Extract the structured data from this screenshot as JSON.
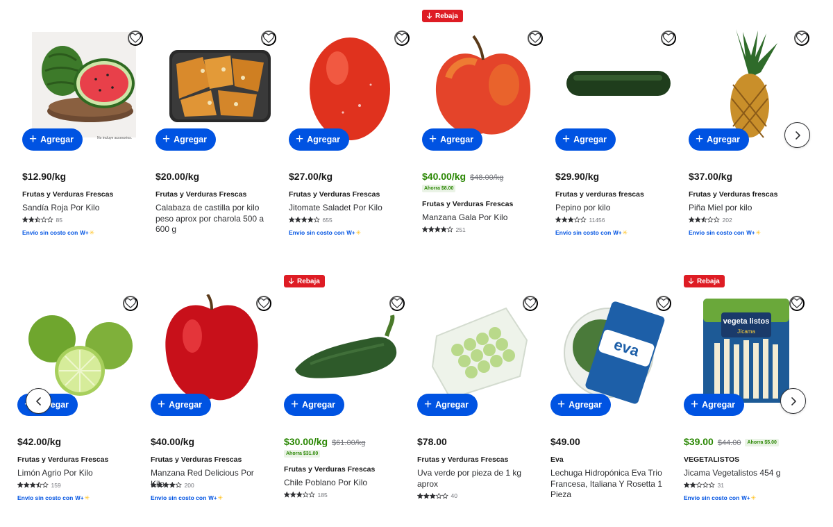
{
  "labels": {
    "add": "Agregar",
    "rebaja": "Rebaja",
    "shipping": "Envío sin costo con",
    "wplus": "W+"
  },
  "colors": {
    "primary": "#0053e2",
    "sale": "#2a8703",
    "badge": "#de1c24",
    "star": "#2e2f32"
  },
  "row1": [
    {
      "price": "$12.90/kg",
      "brand": "Frutas y Verduras Frescas",
      "name": "Sandía Roja Por Kilo",
      "rating": 2.5,
      "reviews": "85",
      "shipping": true,
      "image": "watermelon",
      "image_caption": "No incluye accesorios."
    },
    {
      "price": "$20.00/kg",
      "brand": "Frutas y Verduras Frescas",
      "name": "Calabaza de castilla por kilo peso aprox por charola 500 a 600 g",
      "image": "squash"
    },
    {
      "price": "$27.00/kg",
      "brand": "Frutas y Verduras Frescas",
      "name": "Jitomate Saladet Por Kilo",
      "rating": 4,
      "reviews": "655",
      "shipping": true,
      "image": "tomato"
    },
    {
      "price": "$40.00/kg",
      "was": "$48.00/kg",
      "ahorra": "Ahorra $8.00",
      "rebaja": true,
      "brand": "Frutas y Verduras Frescas",
      "name": "Manzana Gala Por Kilo",
      "rating": 4,
      "reviews": "251",
      "image": "gala-apple"
    },
    {
      "price": "$29.90/kg",
      "brand": "Frutas y verduras frescas",
      "name": "Pepino por kilo",
      "rating": 3,
      "reviews": "11456",
      "shipping": true,
      "image": "cucumber"
    },
    {
      "price": "$37.00/kg",
      "brand": "Frutas y Verduras frescas",
      "name": "Piña Miel por kilo",
      "rating": 2.5,
      "reviews": "202",
      "shipping": true,
      "image": "pineapple"
    }
  ],
  "row2": [
    {
      "price": "$42.00/kg",
      "brand": "Frutas y Verduras Frescas",
      "name": "Limón Agrio Por Kilo",
      "rating": 3.5,
      "reviews": "159",
      "shipping": true,
      "image": "limes"
    },
    {
      "price": "$40.00/kg",
      "brand": "Frutas y Verduras Frescas",
      "name": "Manzana Red Delicious Por Kilo",
      "rating": 4,
      "reviews": "200",
      "shipping": true,
      "image": "red-apple"
    },
    {
      "price": "$30.00/kg",
      "was": "$61.00/kg",
      "ahorra": "Ahorra $31.00",
      "rebaja": true,
      "brand": "Frutas y Verduras Frescas",
      "name": "Chile Poblano Por Kilo",
      "rating": 3,
      "reviews": "185",
      "image": "poblano"
    },
    {
      "price": "$78.00",
      "brand": "Frutas y Verduras Frescas",
      "name": "Uva verde por pieza de 1 kg aprox",
      "rating": 3,
      "reviews": "40",
      "image": "grapes"
    },
    {
      "price": "$49.00",
      "brand": "Eva",
      "name": "Lechuga Hidropónica Eva Trio Francesa, Italiana Y Rosetta 1 Pieza",
      "image": "lettuce",
      "logo_text": "eva"
    },
    {
      "price": "$39.00",
      "was": "$44.00",
      "ahorra": "Ahorra $5.00",
      "ahorra_inline": true,
      "rebaja": true,
      "brand": "VEGETALISTOS",
      "name": "Jicama Vegetalistos 454 g",
      "rating": 2,
      "reviews": "31",
      "shipping": true,
      "image": "jicama",
      "logo_text": "vegeta listos",
      "logo_sub": "Jícama"
    }
  ],
  "carousel": {
    "next_icon": "chevron-right-icon",
    "prev_icon": "chevron-left-icon"
  }
}
